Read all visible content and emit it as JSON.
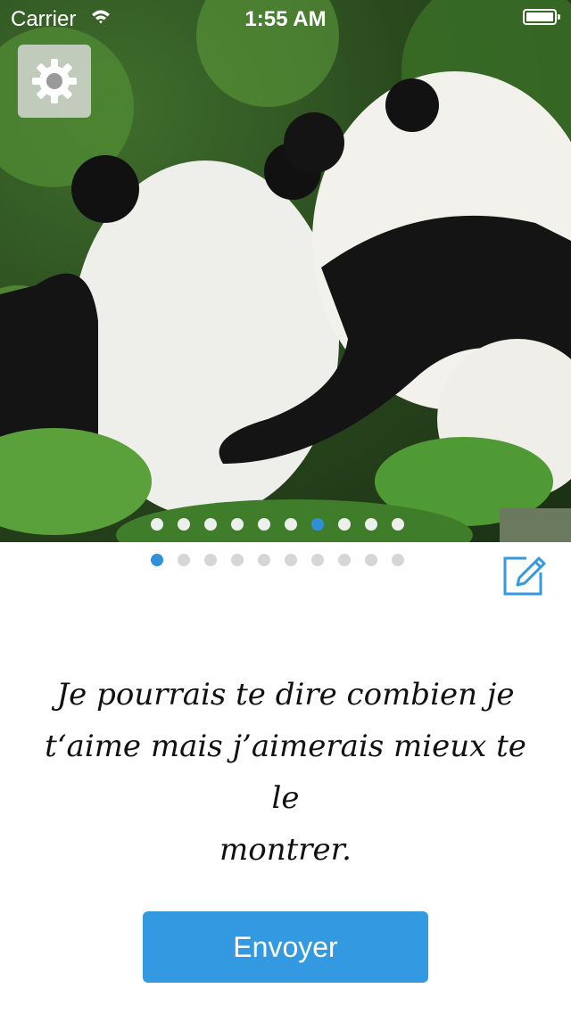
{
  "status_bar": {
    "carrier": "Carrier",
    "time": "1:55 AM",
    "wifi_icon": "wifi-icon",
    "battery_icon": "battery-full-icon"
  },
  "photo": {
    "subject_icon": "panda-photo",
    "settings_icon": "gear-icon"
  },
  "carousel": {
    "overlay_dots": {
      "count": 10,
      "active_index": 6
    },
    "page_dots": {
      "count": 10,
      "active_index": 0
    },
    "active_color": "#2f8fd8"
  },
  "edit_icon": "edit-pencil-icon",
  "message": {
    "line1": "Je pourrais te dire combien je",
    "line2": "t‘aime mais j’aimerais mieux te le",
    "line3": "montrer."
  },
  "send_button": {
    "label": "Envoyer",
    "color": "#3399e0"
  }
}
